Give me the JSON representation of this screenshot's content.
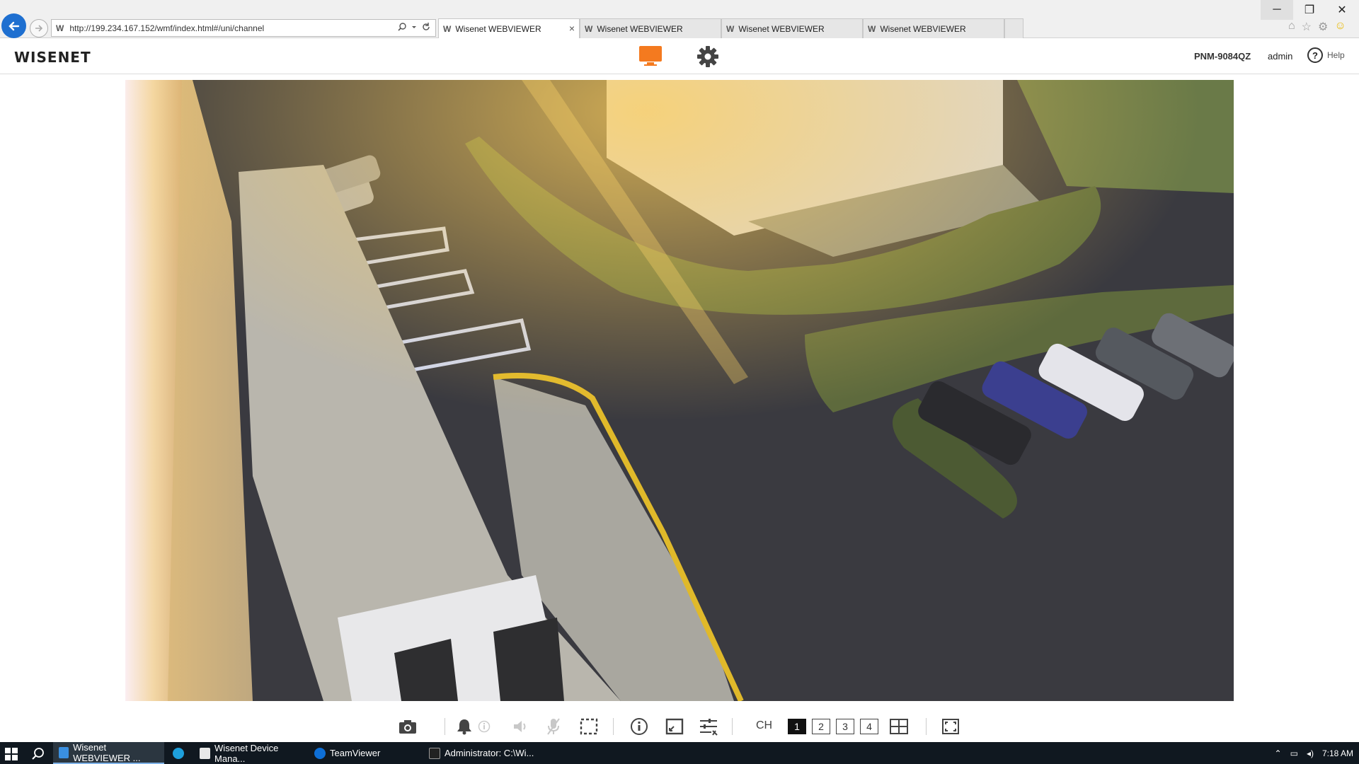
{
  "browser": {
    "url": "http://199.234.167.152/wmf/index.html#/uni/channel",
    "tabs": [
      {
        "label": "Wisenet WEBVIEWER",
        "active": true
      },
      {
        "label": "Wisenet WEBVIEWER",
        "active": false
      },
      {
        "label": "Wisenet WEBVIEWER",
        "active": false
      },
      {
        "label": "Wisenet WEBVIEWER",
        "active": false
      }
    ],
    "tab_close": "×",
    "favicon_letter": "W",
    "window_controls": {
      "minimize": "─",
      "restore": "❐",
      "close": "✕"
    },
    "tool_icons": [
      "home-icon",
      "favorites-star-icon",
      "tools-gear-icon",
      "feedback-smiley-icon"
    ]
  },
  "app": {
    "logo": "WISENET",
    "model": "PNM-9084QZ",
    "user": "admin",
    "help": "Help",
    "accent_color": "#f47a1f"
  },
  "toolbar": {
    "ch_label": "CH",
    "channels": [
      "1",
      "2",
      "3",
      "4"
    ],
    "active_channel": "1",
    "icons": [
      "capture-camera-icon",
      "alarm-bell-icon",
      "alarm-info-icon",
      "speaker-icon",
      "microphone-icon",
      "crop-area-icon",
      "info-icon",
      "aspect-ratio-icon",
      "adjust-sliders-icon",
      "split-view-icon",
      "fullscreen-icon"
    ]
  },
  "taskbar": {
    "items": [
      {
        "label": "Wisenet WEBVIEWER ...",
        "active": true
      },
      {
        "label": "",
        "active": false
      },
      {
        "label": "Wisenet Device Mana...",
        "active": false
      },
      {
        "label": "TeamViewer",
        "active": false
      },
      {
        "label": "Administrator: C:\\Wi...",
        "active": false
      }
    ],
    "time": "7:18 AM"
  }
}
